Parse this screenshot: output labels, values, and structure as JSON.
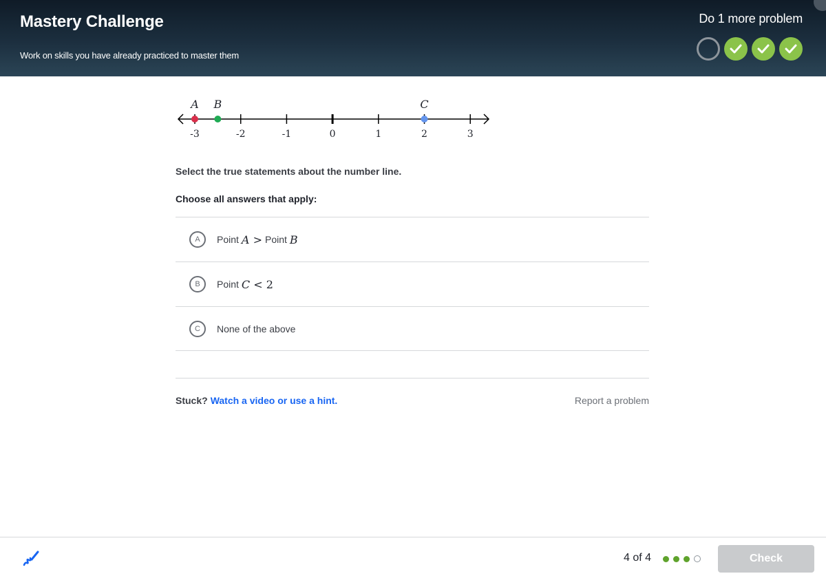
{
  "header": {
    "title": "Mastery Challenge",
    "subtitle": "Work on skills you have already practiced to master them",
    "status": "Do 1 more problem",
    "progress": [
      "empty",
      "done",
      "done",
      "done"
    ]
  },
  "number_line": {
    "ticks": [
      "-3",
      "-2",
      "-1",
      "0",
      "1",
      "2",
      "3"
    ],
    "points": [
      {
        "label": "A",
        "value": -3,
        "color": "#d92f4b"
      },
      {
        "label": "B",
        "value": -2.5,
        "color": "#1fab54"
      },
      {
        "label": "C",
        "value": 2,
        "color": "#6495ed"
      }
    ]
  },
  "question": {
    "prompt": "Select the true statements about the number line.",
    "instruction": "Choose all answers that apply:",
    "choices": [
      {
        "letter": "A",
        "text": "Point",
        "math_a": "A",
        "op": ">",
        "text2": "Point",
        "math_b": "B"
      },
      {
        "letter": "B",
        "text": "Point",
        "math_a": "C",
        "op": "<",
        "math_b": "2"
      },
      {
        "letter": "C",
        "text": "None of the above"
      }
    ]
  },
  "help": {
    "stuck": "Stuck?",
    "hint_link": "Watch a video or use a hint.",
    "report": "Report a problem"
  },
  "footer": {
    "counter": "4 of 4",
    "dots": [
      "done",
      "done",
      "done",
      "empty"
    ],
    "check": "Check"
  },
  "colors": {
    "accent": "#1865f2",
    "success": "#8bc34a"
  },
  "icons": [
    "checkmark-icon",
    "scratchpad-icon"
  ]
}
